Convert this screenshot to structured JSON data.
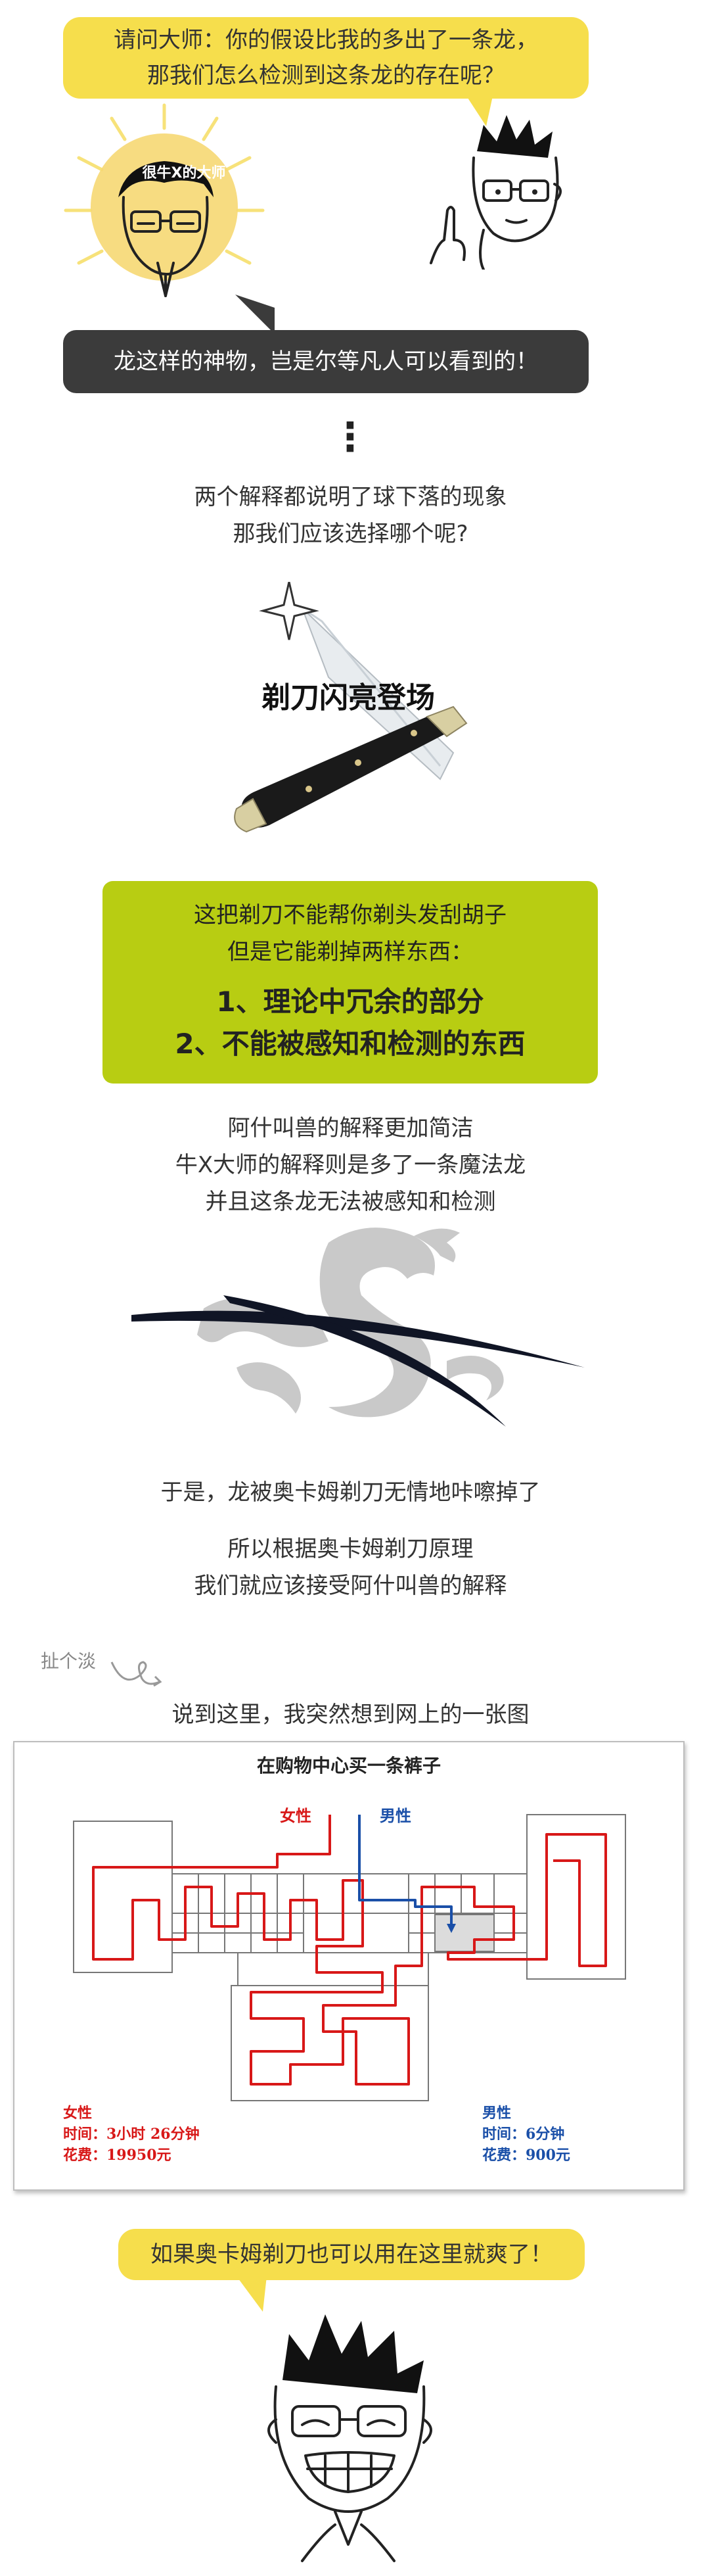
{
  "bubble_top": {
    "line1": "请问大师：你的假设比我的多出了一条龙，",
    "line2": "那我们怎么检测到这条龙的存在呢？"
  },
  "master_badge": "很牛X的大师",
  "bubble_dark": "龙这样的神物，岂是尔等凡人可以看到的！",
  "dots": "⋮",
  "question": {
    "line1": "两个解释都说明了球下落的现象",
    "line2": "那我们应该选择哪个呢?"
  },
  "razor_title": "剃刀闪亮登场",
  "green_box": {
    "line1": "这把剃刀不能帮你剃头发刮胡子",
    "line2": "但是它能剃掉两样东西：",
    "item1": "1、理论中冗余的部分",
    "item2": "2、不能被感知和检测的东西"
  },
  "explain": {
    "line1": "阿什叫兽的解释更加简洁",
    "line2": "牛X大师的解释则是多了一条魔法龙",
    "line3": "并且这条龙无法被感知和检测"
  },
  "conclusion": {
    "line1": "于是，龙被奥卡姆剃刀无情地咔嚓掉了",
    "line2": "所以根据奥卡姆剃刀原理",
    "line3": "我们就应该接受阿什叫兽的解释"
  },
  "aside_label": "扯个淡",
  "aside_text": "说到这里，我突然想到网上的一张图",
  "map": {
    "title": "在购物中心买一条裤子",
    "female_label": "女性",
    "male_label": "男性",
    "female_stats": {
      "label": "女性",
      "time": "时间：3小时 26分钟",
      "cost": "花费：19950元"
    },
    "male_stats": {
      "label": "男性",
      "time": "时间：6分钟",
      "cost": "花费：900元"
    },
    "colors": {
      "female": "#d81818",
      "male": "#1a4fa8"
    }
  },
  "bubble_bottom": "如果奥卡姆剃刀也可以用在这里就爽了！"
}
